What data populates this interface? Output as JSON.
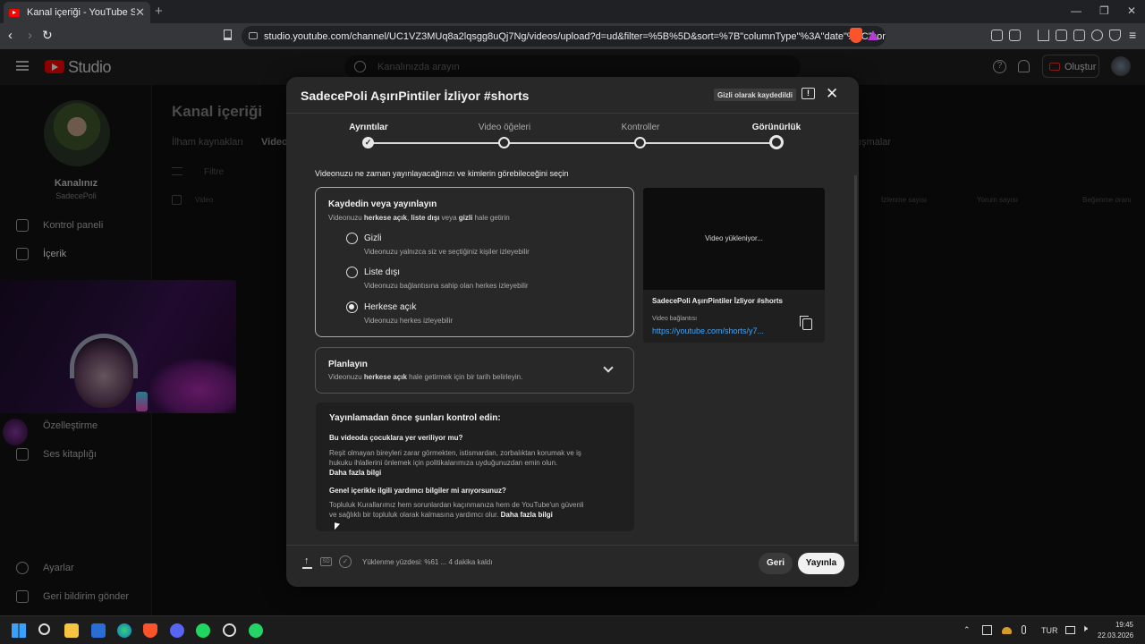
{
  "browser": {
    "tab_title": "Kanal içeriği - YouTube Studio",
    "tab_close": "✕",
    "new_tab": "+",
    "window_minimize": "—",
    "window_restore": "❐",
    "window_close": "✕",
    "url": "studio.youtube.com/channel/UC1VZ3MUq8a2lqsgg8uQj7Ng/videos/upload?d=ud&filter=%5B%5D&sort=%7B\"columnType\"%3A\"date\"%2C\"sortOrd..."
  },
  "studio": {
    "logo_text": "Studio",
    "search_placeholder": "Kanalınızda arayın",
    "create_label": "Oluştur"
  },
  "sidebar": {
    "channel_title": "Kanalınız",
    "channel_name": "SadecePoli",
    "items": [
      {
        "label": "Kontrol paneli",
        "icon": "dashboard-icon"
      },
      {
        "label": "İçerik",
        "icon": "content-icon"
      },
      {
        "label": "Özelleştirme",
        "icon": "customize-icon"
      },
      {
        "label": "Ses kitaplığı",
        "icon": "audio-library-icon"
      }
    ],
    "bottom_items": [
      {
        "label": "Ayarlar",
        "icon": "gear-icon"
      },
      {
        "label": "Geri bildirim gönder",
        "icon": "feedback-icon"
      }
    ]
  },
  "page": {
    "title": "Kanal içeriği",
    "tab_inspiration": "İlham kaynakları",
    "tab_videos": "Videolar",
    "tab_other": "ışmalar",
    "filter_label": "Filtre",
    "col_video": "Video",
    "col_views": "İzlenme sayısı",
    "col_comments": "Yorum sayısı",
    "col_likes": "Beğenme oranı"
  },
  "modal": {
    "title": "SadecePoli AşırıPintiler İzliyor #shorts",
    "saved_badge": "Gizli olarak kaydedildi",
    "steps": [
      "Ayrıntılar",
      "Video öğeleri",
      "Kontroller",
      "Görünürlük"
    ],
    "subtitle": "Videonuzu ne zaman yayınlayacağınızı ve kimlerin görebileceğini seçin",
    "save_or_publish": {
      "heading": "Kaydedin veya yayınlayın",
      "desc_prefix": "Videonuzu ",
      "desc_b1": "herkese açık",
      "desc_sep1": ", ",
      "desc_b2": "liste dışı",
      "desc_sep2": " veya ",
      "desc_b3": "gizli",
      "desc_suffix": " hale getirin",
      "options": [
        {
          "label": "Gizli",
          "desc": "Videonuzu yalnızca siz ve seçtiğiniz kişiler izleyebilir",
          "selected": false
        },
        {
          "label": "Liste dışı",
          "desc": "Videonuzu bağlantısına sahip olan herkes izleyebilir",
          "selected": false
        },
        {
          "label": "Herkese açık",
          "desc": "Videonuzu herkes izleyebilir",
          "selected": true
        }
      ]
    },
    "schedule": {
      "heading": "Planlayın",
      "desc_prefix": "Videonuzu ",
      "desc_bold": "herkese açık",
      "desc_suffix": " hale getirmek için bir tarih belirleyin."
    },
    "checklist": {
      "heading": "Yayınlamadan önce şunları kontrol edin:",
      "q1": "Bu videoda çocuklara yer veriliyor mu?",
      "a1": "Reşit olmayan bireyleri zarar görmekten, istismardan, zorbalıktan korumak ve iş hukuku ihlallerini önlemek için politikalarımıza uyduğunuzdan emin olun.",
      "more1": "Daha fazla bilgi",
      "q2": "Genel içerikle ilgili yardımcı bilgiler mi arıyorsunuz?",
      "a2": "Topluluk Kurallarımız hem sorunlardan kaçınmanıza hem de YouTube'un güvenli ve sağlıklı bir topluluk olarak kalmasına yardımcı olur.",
      "more2": "Daha fazla bilgi"
    },
    "preview": {
      "loading": "Video yükleniyor...",
      "title": "SadecePoli AşırıPintiler İzliyor #shorts",
      "link_label": "Video bağlantısı",
      "link": "https://youtube.com/shorts/y7..."
    },
    "footer": {
      "hd_badge": "SD",
      "progress_text": "Yüklenme yüzdesi: %61 ... 4 dakika kaldı",
      "progress_percent": 61,
      "back_label": "Geri",
      "publish_label": "Yayınla"
    }
  },
  "taskbar": {
    "lang": "TUR",
    "time": "19:45",
    "date": "22.03.2026"
  },
  "colors": {
    "accent": "#3ea6ff",
    "brand": "#ff0000",
    "modal_bg": "#282828"
  }
}
